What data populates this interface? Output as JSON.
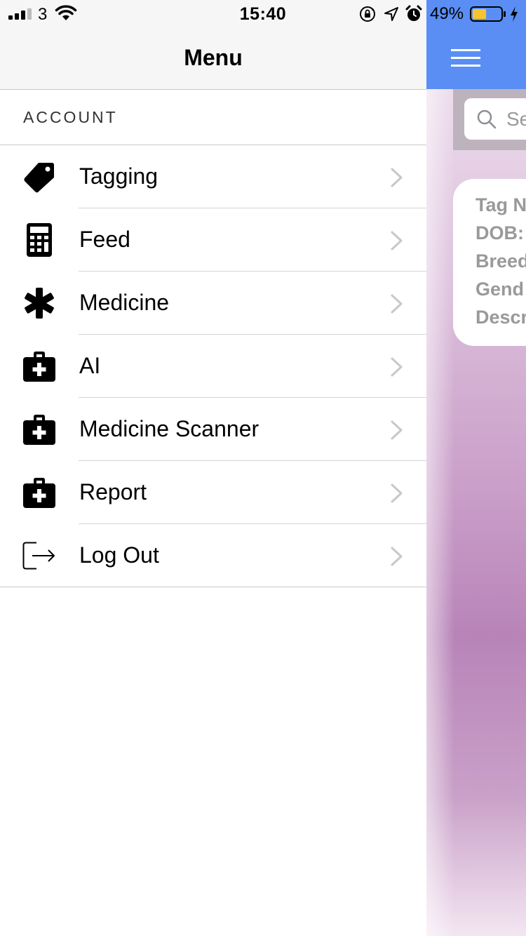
{
  "status_bar": {
    "carrier": "3",
    "time": "15:40",
    "battery_percent": "49%",
    "battery_level": 0.49,
    "signal_bars": 3,
    "icons": [
      "signal-icon",
      "wifi-icon",
      "orientation-lock-icon",
      "location-icon",
      "alarm-icon",
      "battery-icon",
      "charging-icon"
    ]
  },
  "menu": {
    "title": "Menu",
    "section_title": "ACCOUNT",
    "items": [
      {
        "label": "Tagging",
        "icon": "tag-icon"
      },
      {
        "label": "Feed",
        "icon": "calculator-icon"
      },
      {
        "label": "Medicine",
        "icon": "asterisk-icon"
      },
      {
        "label": "AI",
        "icon": "medkit-icon"
      },
      {
        "label": "Medicine Scanner",
        "icon": "medkit-icon"
      },
      {
        "label": "Report",
        "icon": "medkit-icon"
      },
      {
        "label": "Log Out",
        "icon": "sign-out-icon"
      }
    ]
  },
  "background_screen": {
    "search_placeholder": "Se",
    "card_lines": [
      "Tag N",
      "DOB:",
      "Breed",
      "Gend",
      "Descr"
    ]
  },
  "colors": {
    "nav_blue": "#5a8ef4",
    "menu_header_bg": "#f6f6f6",
    "chevron": "#c7c7cc",
    "card_text": "#999999",
    "background_purple": "#b884b8"
  }
}
